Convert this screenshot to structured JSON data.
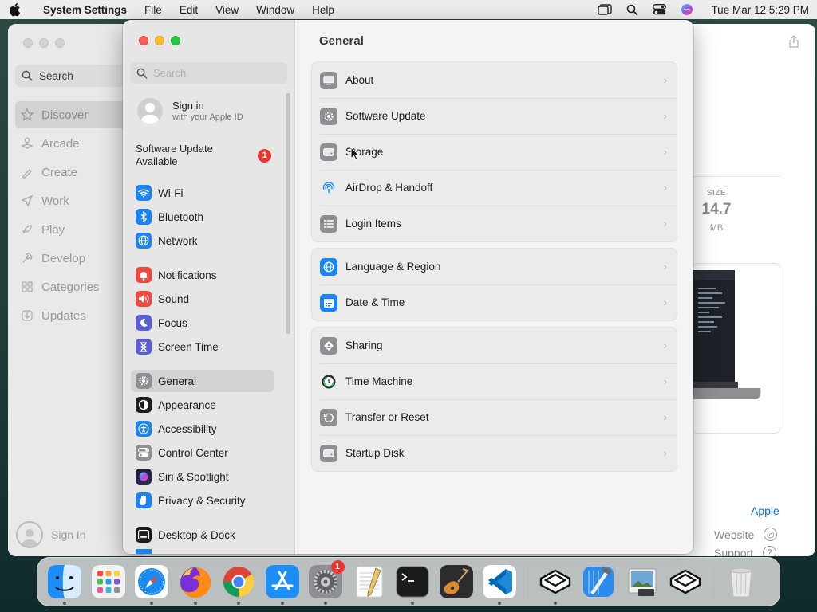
{
  "menubar": {
    "app_name": "System Settings",
    "menus": [
      "File",
      "Edit",
      "View",
      "Window",
      "Help"
    ],
    "clock": "Tue Mar 12  5:29 PM"
  },
  "appstore": {
    "search_label": "Search",
    "nav": [
      {
        "label": "Discover",
        "icon": "star-icon"
      },
      {
        "label": "Arcade",
        "icon": "joystick-icon"
      },
      {
        "label": "Create",
        "icon": "brush-icon"
      },
      {
        "label": "Work",
        "icon": "paperplane-icon"
      },
      {
        "label": "Play",
        "icon": "rocket-icon"
      },
      {
        "label": "Develop",
        "icon": "hammer-icon"
      },
      {
        "label": "Categories",
        "icon": "grid-icon"
      },
      {
        "label": "Updates",
        "icon": "download-icon"
      }
    ],
    "signin_label": "Sign In",
    "size_label": "SIZE",
    "size_value": "14.7",
    "size_unit": "MB",
    "developer_link": "Apple",
    "website_label": "Website",
    "support_label": "Support"
  },
  "settings": {
    "search_placeholder": "Search",
    "signin": {
      "title": "Sign in",
      "subtitle": "with your Apple ID"
    },
    "update_notice": {
      "label": "Software Update Available",
      "badge": "1"
    },
    "sidebar": [
      {
        "label": "Wi-Fi",
        "icon": "wifi-icon",
        "color": "#1a84f5"
      },
      {
        "label": "Bluetooth",
        "icon": "bluetooth-icon",
        "color": "#1a84f5"
      },
      {
        "label": "Network",
        "icon": "globe-icon",
        "color": "#1a84f5"
      },
      {
        "label": "Notifications",
        "icon": "bell-icon",
        "color": "#f0483e"
      },
      {
        "label": "Sound",
        "icon": "speaker-icon",
        "color": "#f0483e"
      },
      {
        "label": "Focus",
        "icon": "moon-icon",
        "color": "#5b5fd6"
      },
      {
        "label": "Screen Time",
        "icon": "hourglass-icon",
        "color": "#5b5fd6"
      },
      {
        "label": "General",
        "icon": "gear-icon",
        "color": "#8e8e93",
        "selected": true
      },
      {
        "label": "Appearance",
        "icon": "appearance-icon",
        "color": "#1d1d1f"
      },
      {
        "label": "Accessibility",
        "icon": "accessibility-icon",
        "color": "#1a84f5"
      },
      {
        "label": "Control Center",
        "icon": "toggles-icon",
        "color": "#8e8e93"
      },
      {
        "label": "Siri & Spotlight",
        "icon": "siri-icon",
        "color": "#c846c8"
      },
      {
        "label": "Privacy & Security",
        "icon": "hand-icon",
        "color": "#1a84f5"
      },
      {
        "label": "Desktop & Dock",
        "icon": "dock-icon",
        "color": "#1d1d1f"
      }
    ],
    "main_title": "General",
    "groups": [
      [
        {
          "label": "About",
          "icon": "display-icon"
        },
        {
          "label": "Software Update",
          "icon": "gear-badge-icon"
        },
        {
          "label": "Storage",
          "icon": "drive-icon"
        },
        {
          "label": "AirDrop & Handoff",
          "icon": "airdrop-icon"
        },
        {
          "label": "Login Items",
          "icon": "list-icon"
        }
      ],
      [
        {
          "label": "Language & Region",
          "icon": "globe-icon"
        },
        {
          "label": "Date & Time",
          "icon": "calendar-icon"
        }
      ],
      [
        {
          "label": "Sharing",
          "icon": "sharing-icon"
        },
        {
          "label": "Time Machine",
          "icon": "time-machine-icon"
        },
        {
          "label": "Transfer or Reset",
          "icon": "reset-icon"
        },
        {
          "label": "Startup Disk",
          "icon": "disk-icon"
        }
      ]
    ]
  },
  "dock": [
    {
      "name": "finder",
      "icon": "finder-icon"
    },
    {
      "name": "launchpad",
      "icon": "launchpad-icon"
    },
    {
      "name": "safari",
      "icon": "safari-icon"
    },
    {
      "name": "firefox",
      "icon": "firefox-icon"
    },
    {
      "name": "chrome",
      "icon": "chrome-icon"
    },
    {
      "name": "app-store",
      "icon": "app-store-icon"
    },
    {
      "name": "system-settings",
      "icon": "system-settings-icon",
      "badge": "1"
    },
    {
      "name": "textedit",
      "icon": "textedit-icon"
    },
    {
      "name": "terminal",
      "icon": "terminal-icon"
    },
    {
      "name": "garageband",
      "icon": "guitar-icon"
    },
    {
      "name": "vscode",
      "icon": "vscode-icon"
    },
    {
      "name": "sketchup-1",
      "icon": "hex-logo-icon"
    },
    {
      "name": "xcode",
      "icon": "xcode-icon"
    },
    {
      "name": "preview",
      "icon": "preview-icon"
    },
    {
      "name": "sketchup-2",
      "icon": "hex-logo-icon"
    },
    {
      "name": "trash",
      "icon": "trash-icon"
    }
  ]
}
